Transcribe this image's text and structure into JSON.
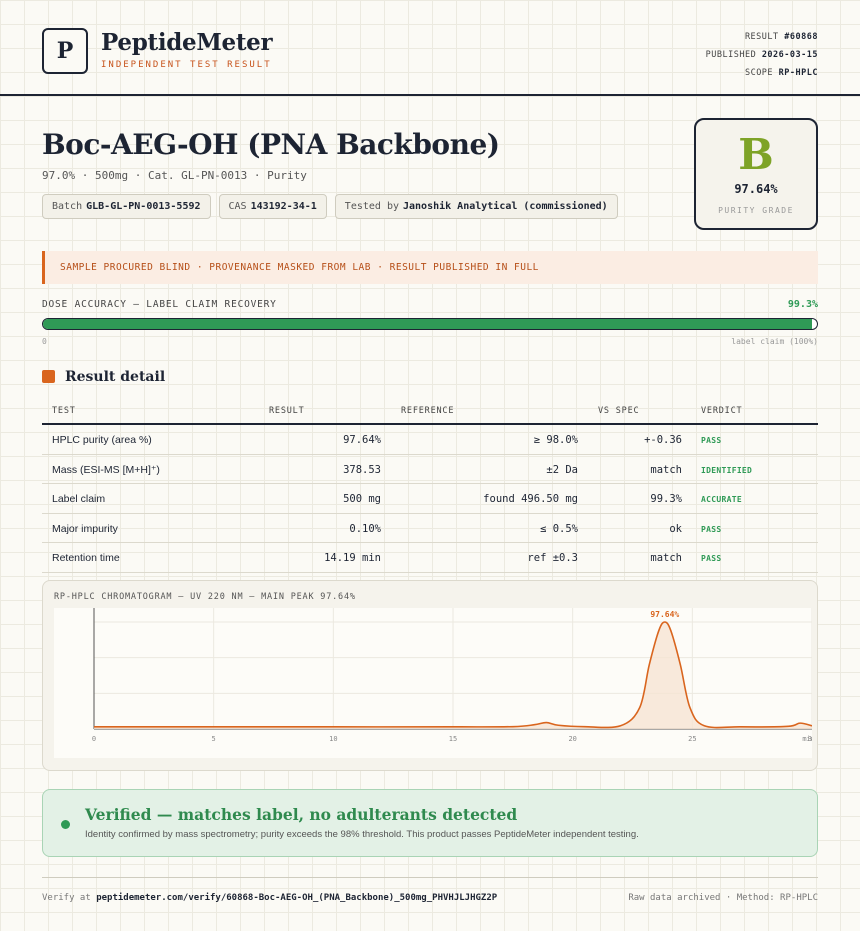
{
  "brand": {
    "logo_letter": "P",
    "name": "PeptideMeter",
    "tagline": "INDEPENDENT TEST RESULT"
  },
  "meta": {
    "result_label": "RESULT",
    "result_value": "#60868",
    "published_label": "PUBLISHED",
    "published_value": "2026-03-15",
    "scope_label": "SCOPE",
    "scope_value": "RP-HPLC"
  },
  "product": {
    "title": "Boc-AEG-OH (PNA Backbone)",
    "subtitle": "97.0% · 500mg · Cat. GL-PN-0013 · Purity",
    "batch_label": "Batch",
    "batch_value": "GLB-GL-PN-0013-5592",
    "cas_label": "CAS",
    "cas_value": "143192-34-1",
    "tested_label": "Tested by",
    "tested_value": "Janoshik Analytical (commissioned)"
  },
  "grade": {
    "letter": "B",
    "percent": "97.64%",
    "label": "PURITY GRADE"
  },
  "notice": "SAMPLE PROCURED BLIND · PROVENANCE MASKED FROM LAB · RESULT PUBLISHED IN FULL",
  "dose": {
    "label": "DOSE ACCURACY — LABEL CLAIM RECOVERY",
    "value": "99.3%",
    "fraction": 0.993,
    "min_label": "0",
    "max_label": "label claim (100%)"
  },
  "section_title": "Result detail",
  "table": {
    "headers": [
      "TEST",
      "RESULT",
      "REFERENCE",
      "VS SPEC",
      "VERDICT"
    ],
    "rows": [
      {
        "test": "HPLC purity (area %)",
        "result": "97.64%",
        "reference": "≥ 98.0%",
        "spec": "+-0.36",
        "verdict": "PASS"
      },
      {
        "test": "Mass (ESI-MS [M+H]⁺)",
        "result": "378.53",
        "reference": "±2 Da",
        "spec": "match",
        "verdict": "IDENTIFIED"
      },
      {
        "test": "Label claim",
        "result": "500 mg",
        "reference": "found 496.50 mg",
        "spec": "99.3%",
        "verdict": "ACCURATE"
      },
      {
        "test": "Major impurity",
        "result": "0.10%",
        "reference": "≤ 0.5%",
        "spec": "ok",
        "verdict": "PASS"
      },
      {
        "test": "Retention time",
        "result": "14.19 min",
        "reference": "ref ±0.3",
        "spec": "match",
        "verdict": "PASS"
      }
    ]
  },
  "chromatogram": {
    "title": "RP-HPLC CHROMATOGRAM — UV 220 NM — MAIN PEAK 97.64%"
  },
  "chart_data": {
    "type": "line",
    "title": "RP-HPLC CHROMATOGRAM — UV 220 NM — MAIN PEAK 97.64%",
    "xlabel": "",
    "ylabel": "",
    "xlim": [
      0,
      30
    ],
    "ylim": [
      0,
      100
    ],
    "x_ticks": [
      "0",
      "5",
      "10",
      "15",
      "20",
      "25",
      "30"
    ],
    "x_unit": "min",
    "peak_label": "97.64%",
    "series": [
      {
        "x": [
          0,
          5,
          10,
          15,
          17.5,
          18.4,
          18.9,
          19.4,
          20.5,
          22.0,
          22.8,
          23.2,
          23.6,
          23.85,
          24.1,
          24.5,
          24.9,
          25.5,
          27,
          29.0,
          29.5,
          30
        ],
        "y": [
          2,
          2,
          2,
          2,
          2.2,
          4,
          6,
          3.5,
          2.2,
          3,
          20,
          60,
          92,
          100,
          92,
          60,
          20,
          3,
          2,
          2.5,
          5.5,
          3
        ]
      }
    ],
    "grid": true,
    "fill": true,
    "colors": {
      "line": "#d9651e",
      "fill": "#f6e3d3"
    }
  },
  "verified": {
    "title": "Verified — matches label, no adulterants detected",
    "text": "Identity confirmed by mass spectrometry; purity exceeds the 98% threshold. This product passes PeptideMeter independent testing."
  },
  "footer": {
    "verify_label": "Verify at",
    "verify_url": "peptidemeter.com/verify/60868-Boc-AEG-OH_(PNA_Backbone)_500mg_PHVHJLJHGZ2P",
    "right": "Raw data archived · Method: RP-HPLC"
  },
  "colors": {
    "accent": "#d9651e",
    "pass": "#2f9a56",
    "ink": "#1d2433",
    "grade": "#7ea327"
  }
}
